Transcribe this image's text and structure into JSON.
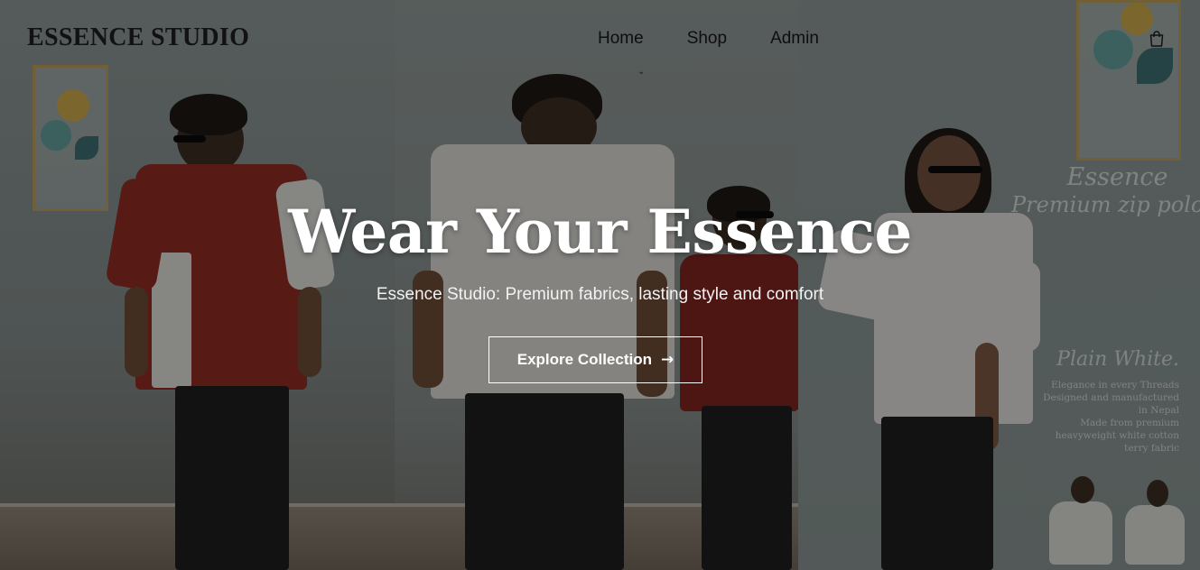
{
  "brand": {
    "logo": "ESSENCE STUDIO"
  },
  "nav": {
    "items": [
      {
        "label": "Home"
      },
      {
        "label": "Shop"
      },
      {
        "label": "Admin"
      }
    ],
    "caret_glyph": "⌄",
    "cart_icon": "shopping-bag-icon"
  },
  "hero": {
    "title": "Wear Your Essence",
    "subtitle": "Essence Studio: Premium fabrics, lasting style and comfort",
    "cta_label": "Explore Collection",
    "cta_icon": "arrow-right-icon",
    "cta_arrow": "→"
  },
  "poster": {
    "brand_line": "Essence",
    "product_line": "Premium zip polos",
    "edition": "Plain White.",
    "details": [
      "Elegance in every Threads",
      "Designed and manufactured",
      "in Nepal",
      "Made from premium",
      "heavyweight white cotton",
      "terry fabric"
    ]
  },
  "colors": {
    "overlay": "#000000",
    "hero_text": "#ffffff",
    "nav_text": "#0e0e0e",
    "shirt_red": "#8e2a22",
    "shirt_white": "#d9d8d3",
    "frame_gold": "#b69a57"
  }
}
